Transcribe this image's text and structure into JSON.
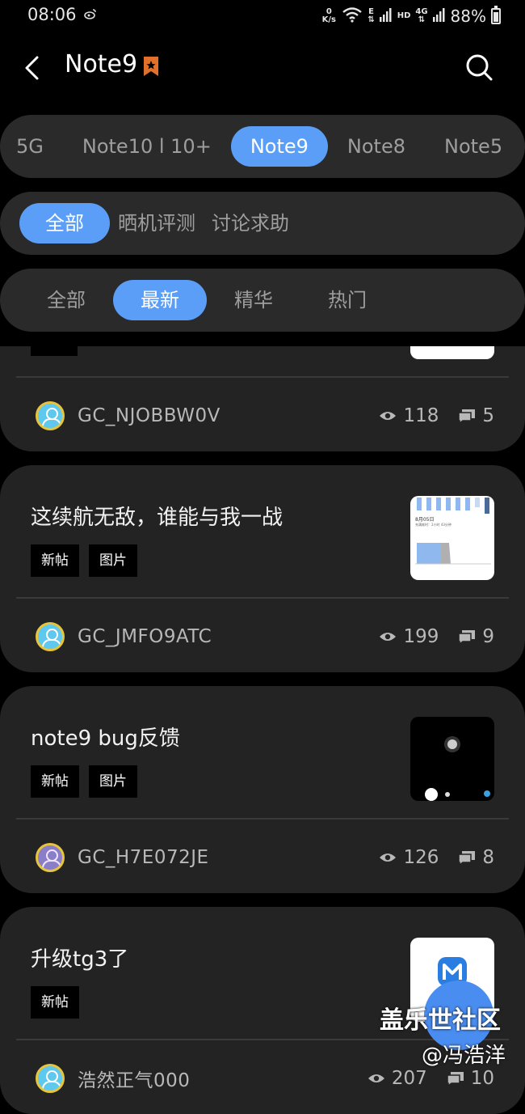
{
  "status_bar": {
    "time": "08:06",
    "net_speed_top": "0",
    "net_speed_unit": "K/s",
    "signal_e": "E",
    "hd": "HD",
    "four_g": "4G",
    "battery": "88%"
  },
  "app_bar": {
    "title": "Note9"
  },
  "device_tabs": [
    "5G",
    "Note10 l 10+",
    "Note9",
    "Note8",
    "Note5"
  ],
  "category_tabs": [
    "全部",
    "晒机评测",
    "讨论求助"
  ],
  "sort_tabs": [
    "全部",
    "最新",
    "精华",
    "热门"
  ],
  "posts": [
    {
      "title": "",
      "tags": [],
      "author": "GC_NJOBBW0V",
      "views": "118",
      "comments": "5"
    },
    {
      "title": "这续航无敌，谁能与我一战",
      "tags": [
        "新帖",
        "图片"
      ],
      "author": "GC_JMFO9ATC",
      "views": "199",
      "comments": "9"
    },
    {
      "title": "note9 bug反馈",
      "tags": [
        "新帖",
        "图片"
      ],
      "author": "GC_H7E072JE",
      "views": "126",
      "comments": "8"
    },
    {
      "title": "升级tg3了",
      "tags": [
        "新帖"
      ],
      "author": "浩然正气000",
      "views": "207",
      "comments": "10"
    }
  ],
  "thumb_text": {
    "date": "8月05日",
    "sub": "充满耗时：2小时 43分钟"
  },
  "watermark": {
    "line1": "盖乐世社区",
    "line2": "@冯浩洋"
  },
  "colors": {
    "accent": "#5b9ef7",
    "card": "#232323",
    "pill_bar": "#2a2a2a",
    "badge": "#e0702a"
  }
}
